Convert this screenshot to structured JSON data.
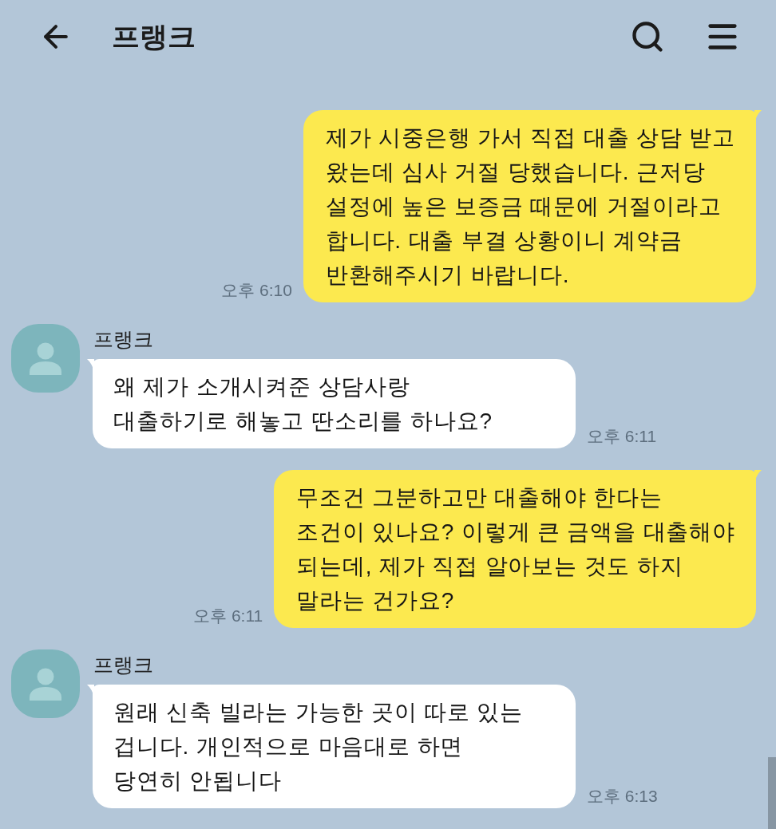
{
  "header": {
    "title": "프랭크"
  },
  "messages": [
    {
      "kind": "sent",
      "text": "제가 시중은행 가서 직접 대출 상담 받고\n왔는데 심사 거절 당했습니다. 근저당\n설정에 높은 보증금 때문에 거절이라고\n합니다. 대출 부결 상황이니 계약금\n반환해주시기 바랍니다.",
      "time": "오후 6:10"
    },
    {
      "kind": "received",
      "sender": "프랭크",
      "text": "왜 제가 소개시켜준 상담사랑\n대출하기로 해놓고 딴소리를 하나요?",
      "time": "오후 6:11"
    },
    {
      "kind": "sent",
      "text": "무조건 그분하고만 대출해야 한다는\n조건이 있나요? 이렇게 큰 금액을 대출해야\n되는데, 제가 직접 알아보는 것도 하지\n말라는 건가요?",
      "time": "오후 6:11"
    },
    {
      "kind": "received",
      "sender": "프랭크",
      "text": "원래 신축 빌라는 가능한 곳이 따로 있는\n겁니다. 개인적으로 마음대로 하면\n당연히 안됩니다",
      "time": "오후 6:13"
    }
  ]
}
